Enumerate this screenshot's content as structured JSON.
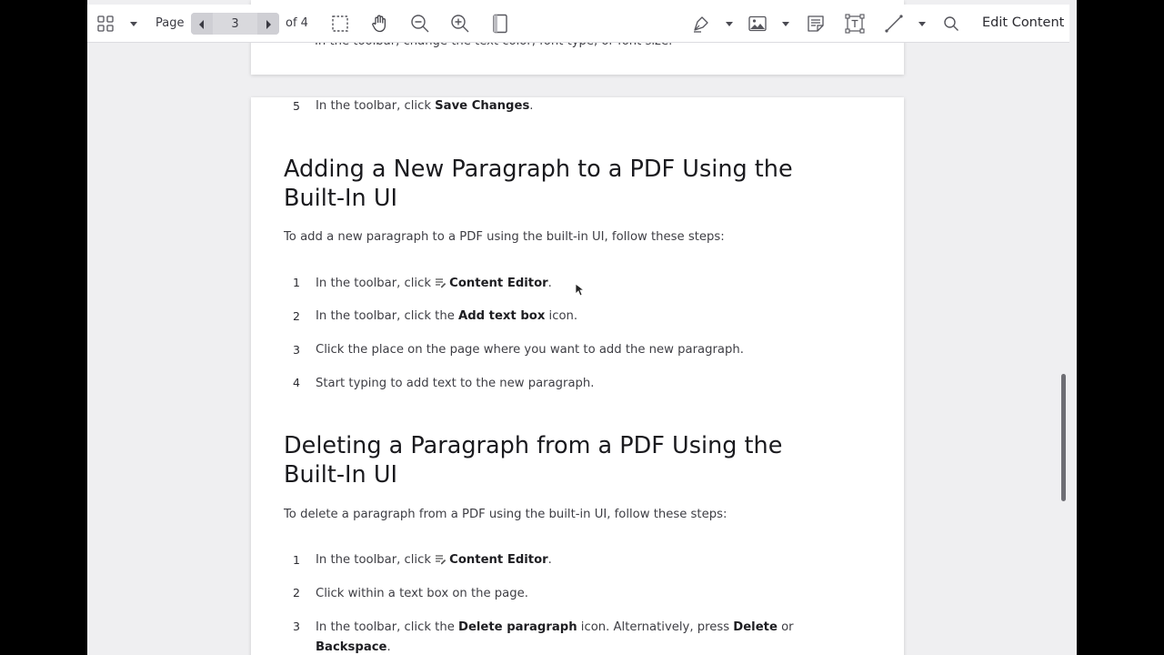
{
  "toolbar": {
    "page_label": "Page",
    "page_value": "3",
    "of_label": "of 4",
    "edit_content_label": "Edit Content"
  },
  "prev_page": {
    "partial_text": "In the toolbar, change the text color, font type, or font size."
  },
  "steps_top": {
    "num": "5",
    "pre": "In the toolbar, click ",
    "bold": "Save Changes",
    "post": "."
  },
  "section_add": {
    "title_line1": "Adding a New Paragraph to a PDF Using the",
    "title_line2": "Built-In UI",
    "intro": "To add a new paragraph to a PDF using the built-in UI, follow these steps:",
    "steps": [
      {
        "num": "1",
        "pre": "In the toolbar, click ",
        "bold": "Content Editor",
        "post": "."
      },
      {
        "num": "2",
        "pre": "In the toolbar, click the ",
        "bold": "Add text box",
        "post": " icon."
      },
      {
        "num": "3",
        "pre": "Click the place on the page where you want to add the new paragraph.",
        "bold": "",
        "post": ""
      },
      {
        "num": "4",
        "pre": "Start typing to add text to the new paragraph.",
        "bold": "",
        "post": ""
      }
    ]
  },
  "section_delete": {
    "title_line1": "Deleting a Paragraph from a PDF Using the",
    "title_line2": "Built-In UI",
    "intro": "To delete a paragraph from a PDF using the built-in UI, follow these steps:",
    "steps": [
      {
        "num": "1",
        "pre": "In the toolbar, click ",
        "bold": "Content Editor",
        "post": "."
      },
      {
        "num": "2",
        "pre": "Click within a text box on the page.",
        "bold": "",
        "post": ""
      },
      {
        "num": "3",
        "pre": "In the toolbar, click the ",
        "bold": "Delete paragraph",
        "post": " icon. Alternatively, press ",
        "bold2": "Delete",
        "post2": " or",
        "line2_bold": "Backspace",
        "line2_post": "."
      }
    ]
  }
}
